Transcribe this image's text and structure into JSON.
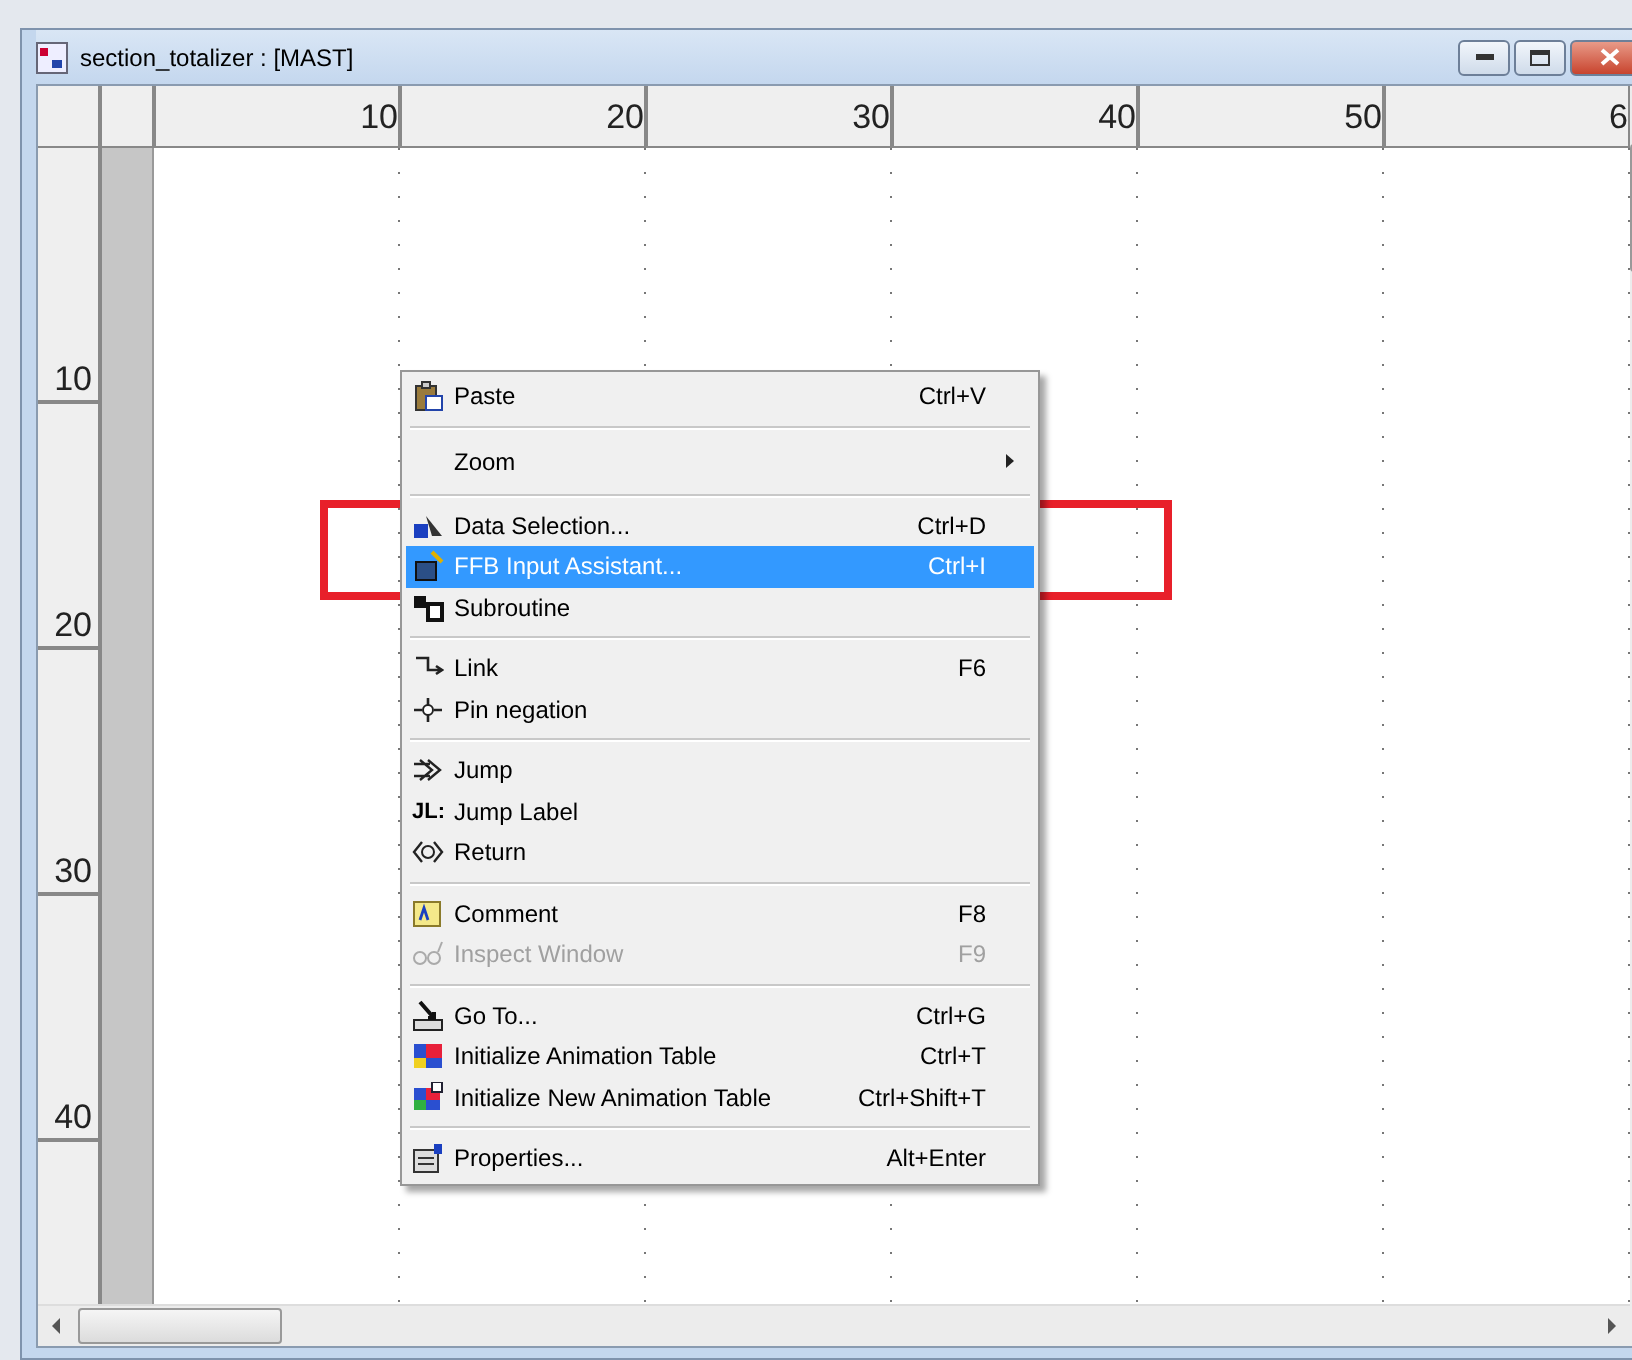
{
  "window": {
    "title": "section_totalizer : [MAST]"
  },
  "column_ruler": [
    "10",
    "20",
    "30",
    "40",
    "50",
    "6"
  ],
  "row_ruler": [
    "10",
    "20",
    "30",
    "40"
  ],
  "context_menu": {
    "items": [
      {
        "kind": "item",
        "label": "Paste",
        "shortcut": "Ctrl+V",
        "selected": false,
        "disabled": false
      },
      {
        "kind": "separator"
      },
      {
        "kind": "submenu",
        "label": "Zoom",
        "selected": false,
        "disabled": false
      },
      {
        "kind": "separator"
      },
      {
        "kind": "item",
        "label": "Data Selection...",
        "shortcut": "Ctrl+D",
        "selected": false,
        "disabled": false
      },
      {
        "kind": "item",
        "label": "FFB Input Assistant...",
        "shortcut": "Ctrl+I",
        "selected": true,
        "disabled": false
      },
      {
        "kind": "item",
        "label": "Subroutine",
        "selected": false,
        "disabled": false
      },
      {
        "kind": "separator"
      },
      {
        "kind": "item",
        "label": "Link",
        "shortcut": "F6",
        "selected": false,
        "disabled": false
      },
      {
        "kind": "item",
        "label": "Pin negation",
        "selected": false,
        "disabled": false
      },
      {
        "kind": "separator"
      },
      {
        "kind": "item",
        "label": "Jump",
        "selected": false,
        "disabled": false
      },
      {
        "kind": "item",
        "icon_text": "JL:",
        "label": "Jump Label",
        "selected": false,
        "disabled": false
      },
      {
        "kind": "item",
        "label": "Return",
        "selected": false,
        "disabled": false
      },
      {
        "kind": "separator"
      },
      {
        "kind": "item",
        "label": "Comment",
        "shortcut": "F8",
        "selected": false,
        "disabled": false
      },
      {
        "kind": "item",
        "label": "Inspect Window",
        "shortcut": "F9",
        "selected": false,
        "disabled": true
      },
      {
        "kind": "separator"
      },
      {
        "kind": "item",
        "label": "Go To...",
        "shortcut": "Ctrl+G",
        "selected": false,
        "disabled": false
      },
      {
        "kind": "item",
        "label": "Initialize Animation Table",
        "shortcut": "Ctrl+T",
        "selected": false,
        "disabled": false
      },
      {
        "kind": "item",
        "label": "Initialize New Animation Table",
        "shortcut": "Ctrl+Shift+T",
        "selected": false,
        "disabled": false
      },
      {
        "kind": "separator"
      },
      {
        "kind": "item",
        "label": "Properties...",
        "shortcut": "Alt+Enter",
        "selected": false,
        "disabled": false
      }
    ]
  }
}
